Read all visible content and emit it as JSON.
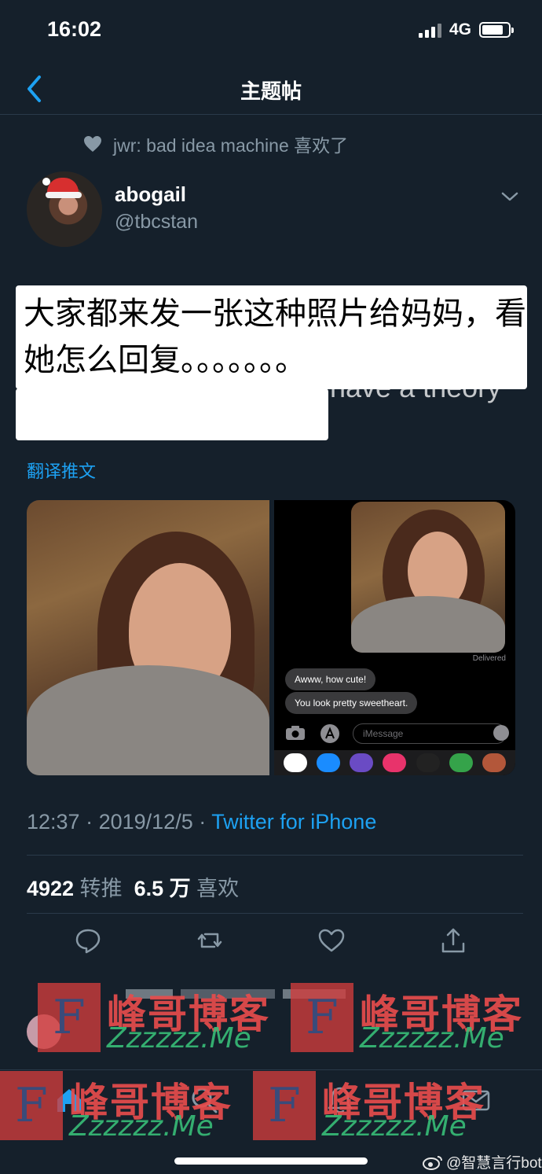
{
  "status_bar": {
    "time": "16:02",
    "network": "4G"
  },
  "nav": {
    "title": "主题帖"
  },
  "social_context": {
    "text": "jwr: bad idea machine 喜欢了"
  },
  "tweet": {
    "display_name": "abogail",
    "handle": "@tbcstan",
    "caption_overlay": "大家都来发一张这种照片给妈妈，看她怎么回复。。。。。。。",
    "underlying_text_fragment": "have a theory",
    "translate_label": "翻译推文",
    "screenshot": {
      "delivered": "Delivered",
      "messages": [
        "Awww, how cute!",
        "You look pretty sweetheart."
      ],
      "input_placeholder": "iMessage"
    },
    "time": "12:37",
    "date": "2019/12/5",
    "source": "Twitter for iPhone",
    "retweets_count": "4922",
    "retweets_label": "转推",
    "likes_count": "6.5 万",
    "likes_label": "喜欢"
  },
  "watermarks": {
    "title": "峰哥博客",
    "subtitle": "Zzzzzz.Me",
    "badge": "F"
  },
  "credit": {
    "text": "@智慧言行bot"
  },
  "colors": {
    "background": "#15202b",
    "accent": "#1da1f2",
    "muted": "#8899a6",
    "watermark_red": "#e74c4c",
    "watermark_green": "#37be78"
  }
}
